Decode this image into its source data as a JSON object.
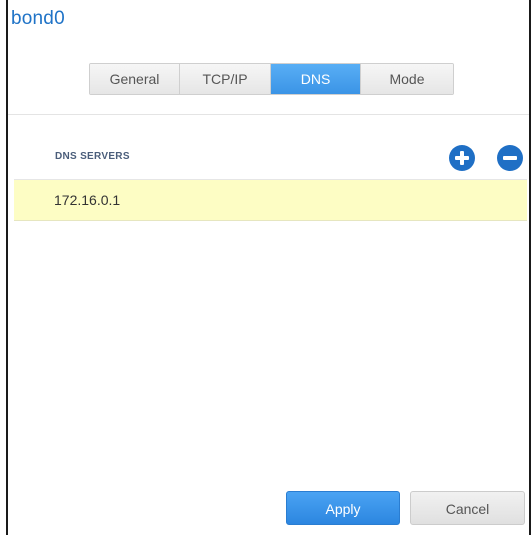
{
  "window": {
    "title": "bond0"
  },
  "tabs": [
    {
      "label": "General",
      "active": false
    },
    {
      "label": "TCP/IP",
      "active": false
    },
    {
      "label": "DNS",
      "active": true
    },
    {
      "label": "Mode",
      "active": false
    }
  ],
  "dns": {
    "section_label": "DNS SERVERS",
    "servers": [
      "172.16.0.1"
    ],
    "add_icon": "plus-circle-icon",
    "remove_icon": "minus-circle-icon"
  },
  "footer": {
    "apply_label": "Apply",
    "cancel_label": "Cancel"
  },
  "colors": {
    "accent": "#3b94e6",
    "title": "#1f73c7",
    "selected_row": "#fdfdc4",
    "icon_button": "#1f6fc5"
  }
}
